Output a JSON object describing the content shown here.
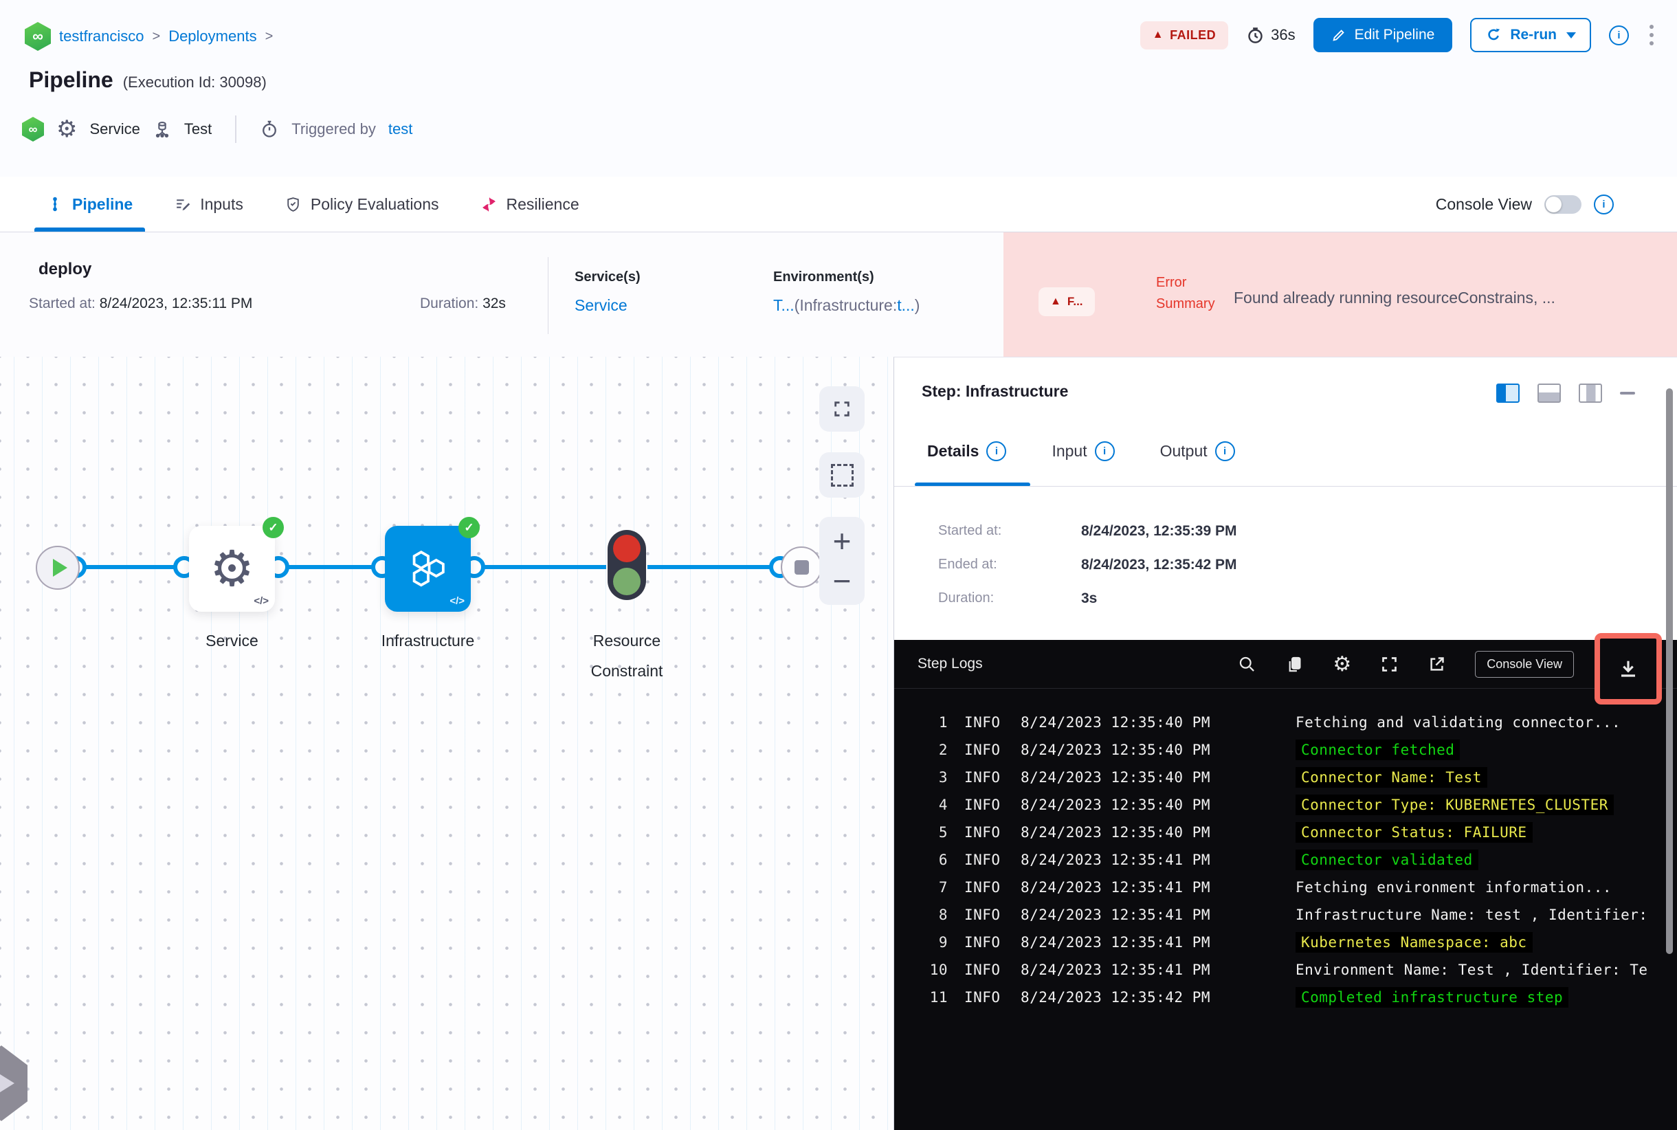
{
  "colors": {
    "accent_blue": "#0278d5",
    "edge_blue": "#0092e4",
    "failed_red": "#b41710",
    "error_strip_pink": "#fbdddd",
    "success_green": "#3dbf4a",
    "log_green": "#12d612",
    "log_yellow": "#e9e94c",
    "highlight_red": "#f4695e"
  },
  "icons": {
    "infinity": "∞",
    "gear": "⚙",
    "code": "</>",
    "check": "✓",
    "warning_triangle": "▲",
    "info": "i",
    "plus": "+",
    "minus": "−"
  },
  "header": {
    "breadcrumb": {
      "items": [
        "testfrancisco",
        "Deployments"
      ],
      "separator": ">"
    },
    "status_badge": "FAILED",
    "duration_badge": "36s",
    "edit_pipeline_label": "Edit Pipeline",
    "rerun_label": "Re-run",
    "title": "Pipeline",
    "execution_id": "(Execution Id: 30098)",
    "meta": {
      "service_label": "Service",
      "stage_label": "Test",
      "triggered_by_label": "Triggered by",
      "triggered_by_value": "test"
    }
  },
  "tabs": {
    "items": [
      {
        "label": "Pipeline",
        "active": true
      },
      {
        "label": "Inputs",
        "active": false
      },
      {
        "label": "Policy Evaluations",
        "active": false
      },
      {
        "label": "Resilience",
        "active": false
      }
    ],
    "console_view_label": "Console View"
  },
  "stage_summary": {
    "name": "deploy",
    "started_label": "Started at:",
    "started_value": "8/24/2023, 12:35:11 PM",
    "duration_label": "Duration:",
    "duration_value": "32s",
    "services_label": "Service(s)",
    "services_value": "Service",
    "environments_label": "Environment(s)",
    "env_value_parts": [
      "T...",
      "(Infrastructure:",
      "t...",
      ")"
    ],
    "error_badge": "F...",
    "error_summary_label": "Error Summary",
    "error_summary_text": "Found already running resourceConstrains, ..."
  },
  "graph": {
    "labels": {
      "service": "Service",
      "infrastructure": "Infrastructure",
      "resource_constraint": "Resource Constraint"
    }
  },
  "step_panel": {
    "title": "Step: Infrastructure",
    "tabs": [
      {
        "label": "Details",
        "active": true
      },
      {
        "label": "Input",
        "active": false
      },
      {
        "label": "Output",
        "active": false
      }
    ],
    "details": [
      {
        "label": "Started at:",
        "value": "8/24/2023, 12:35:39 PM"
      },
      {
        "label": "Ended at:",
        "value": "8/24/2023, 12:35:42 PM"
      },
      {
        "label": "Duration:",
        "value": "3s"
      }
    ]
  },
  "logs": {
    "title": "Step Logs",
    "console_view_label": "Console View",
    "lines": [
      {
        "num": "1",
        "level": "INFO",
        "time": "8/24/2023 12:35:40 PM",
        "msg": "Fetching and validating connector...",
        "color": "white"
      },
      {
        "num": "2",
        "level": "INFO",
        "time": "8/24/2023 12:35:40 PM",
        "msg": "Connector fetched",
        "color": "green"
      },
      {
        "num": "3",
        "level": "INFO",
        "time": "8/24/2023 12:35:40 PM",
        "msg": "Connector Name: Test",
        "color": "yellow"
      },
      {
        "num": "4",
        "level": "INFO",
        "time": "8/24/2023 12:35:40 PM",
        "msg": "Connector Type: KUBERNETES_CLUSTER",
        "color": "yellow"
      },
      {
        "num": "5",
        "level": "INFO",
        "time": "8/24/2023 12:35:40 PM",
        "msg": "Connector Status: FAILURE",
        "color": "yellow"
      },
      {
        "num": "6",
        "level": "INFO",
        "time": "8/24/2023 12:35:41 PM",
        "msg": "Connector validated",
        "color": "green"
      },
      {
        "num": "7",
        "level": "INFO",
        "time": "8/24/2023 12:35:41 PM",
        "msg": "Fetching environment information...",
        "color": "white"
      },
      {
        "num": "8",
        "level": "INFO",
        "time": "8/24/2023 12:35:41 PM",
        "msg": "Infrastructure Name: test , Identifier:",
        "color": "white"
      },
      {
        "num": "9",
        "level": "INFO",
        "time": "8/24/2023 12:35:41 PM",
        "msg": "Kubernetes Namespace: abc",
        "color": "yellow"
      },
      {
        "num": "10",
        "level": "INFO",
        "time": "8/24/2023 12:35:41 PM",
        "msg": "Environment Name: Test , Identifier: Te",
        "color": "white"
      },
      {
        "num": "11",
        "level": "INFO",
        "time": "8/24/2023 12:35:42 PM",
        "msg": "Completed infrastructure step",
        "color": "green"
      }
    ]
  }
}
